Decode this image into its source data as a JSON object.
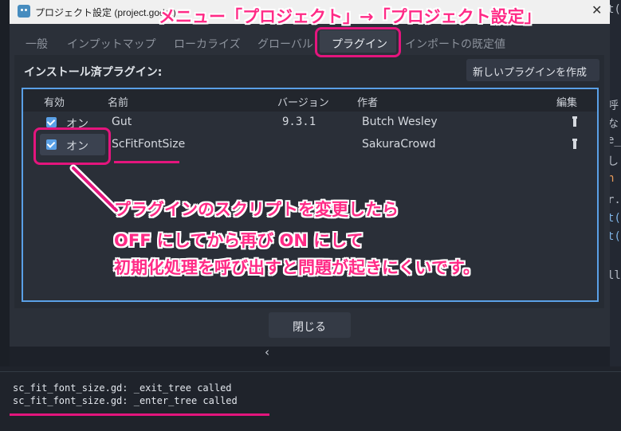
{
  "window": {
    "title": "プロジェクト設定 (project.godot)",
    "close_glyph": "✕"
  },
  "tabs": [
    {
      "label": "一般"
    },
    {
      "label": "インプットマップ"
    },
    {
      "label": "ローカライズ"
    },
    {
      "label": "グローバル"
    },
    {
      "label": "プラグイン"
    },
    {
      "label": "インポートの既定値"
    }
  ],
  "plugins": {
    "section_title": "インストール済プラグイン:",
    "create_button": "新しいプラグインを作成",
    "columns": [
      "有効",
      "名前",
      "バージョン",
      "作者",
      "編集"
    ],
    "rows": [
      {
        "status": "オン",
        "name": "Gut",
        "version": "9.3.1",
        "author": "Butch Wesley",
        "enabled": true
      },
      {
        "status": "オン",
        "name": "ScFitFontSize",
        "version": "",
        "author": "SakuraCrowd",
        "enabled": true
      }
    ],
    "close_button": "閉じる"
  },
  "console": [
    "sc_fit_font_size.gd: _exit_tree called",
    "sc_fit_font_size.gd: _enter_tree called"
  ],
  "annotations": {
    "header_callout": "メニュー「プロジェクト」→「プロジェクト設定」",
    "body_lines": [
      "プラグインのスクリプトを変更したら",
      "OFF にしてから再び ON にして",
      "初期化処理を呼び出すと問題が起きにくいです。"
    ],
    "accent_color": "#e4157d"
  },
  "background_fragments": [
    "t(",
    "呼",
    "な",
    "e_",
    "し",
    "n",
    "r.",
    "t(",
    "t(",
    "ll"
  ],
  "chevron_glyph": "‹",
  "icons": [
    "godot-icon",
    "close-icon",
    "pencil-icon",
    "checkbox-icon",
    "chevron-left-icon"
  ]
}
